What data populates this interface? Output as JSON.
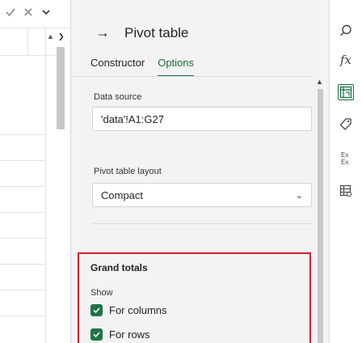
{
  "formula_bar": {
    "icons": [
      "check-icon",
      "close-icon",
      "chevron-down-icon"
    ]
  },
  "panel": {
    "title": "Pivot table",
    "tabs": [
      {
        "label": "Constructor",
        "active": false
      },
      {
        "label": "Options",
        "active": true
      }
    ],
    "data_source": {
      "label": "Data source",
      "value": "'data'!A1:G27"
    },
    "layout": {
      "label": "Pivot table layout",
      "value": "Compact"
    },
    "grand_totals": {
      "title": "Grand totals",
      "show_label": "Show",
      "options": [
        {
          "label": "For columns",
          "checked": true
        },
        {
          "label": "For rows",
          "checked": true
        }
      ]
    }
  },
  "rail": {
    "icons": [
      "search-icon",
      "formula-icon",
      "pivot-table-icon",
      "tag-icon",
      "text-transform-icon",
      "table-settings-icon"
    ],
    "active": "pivot-table-icon"
  },
  "colors": {
    "accent": "#217346",
    "highlight_border": "#d0202a"
  }
}
